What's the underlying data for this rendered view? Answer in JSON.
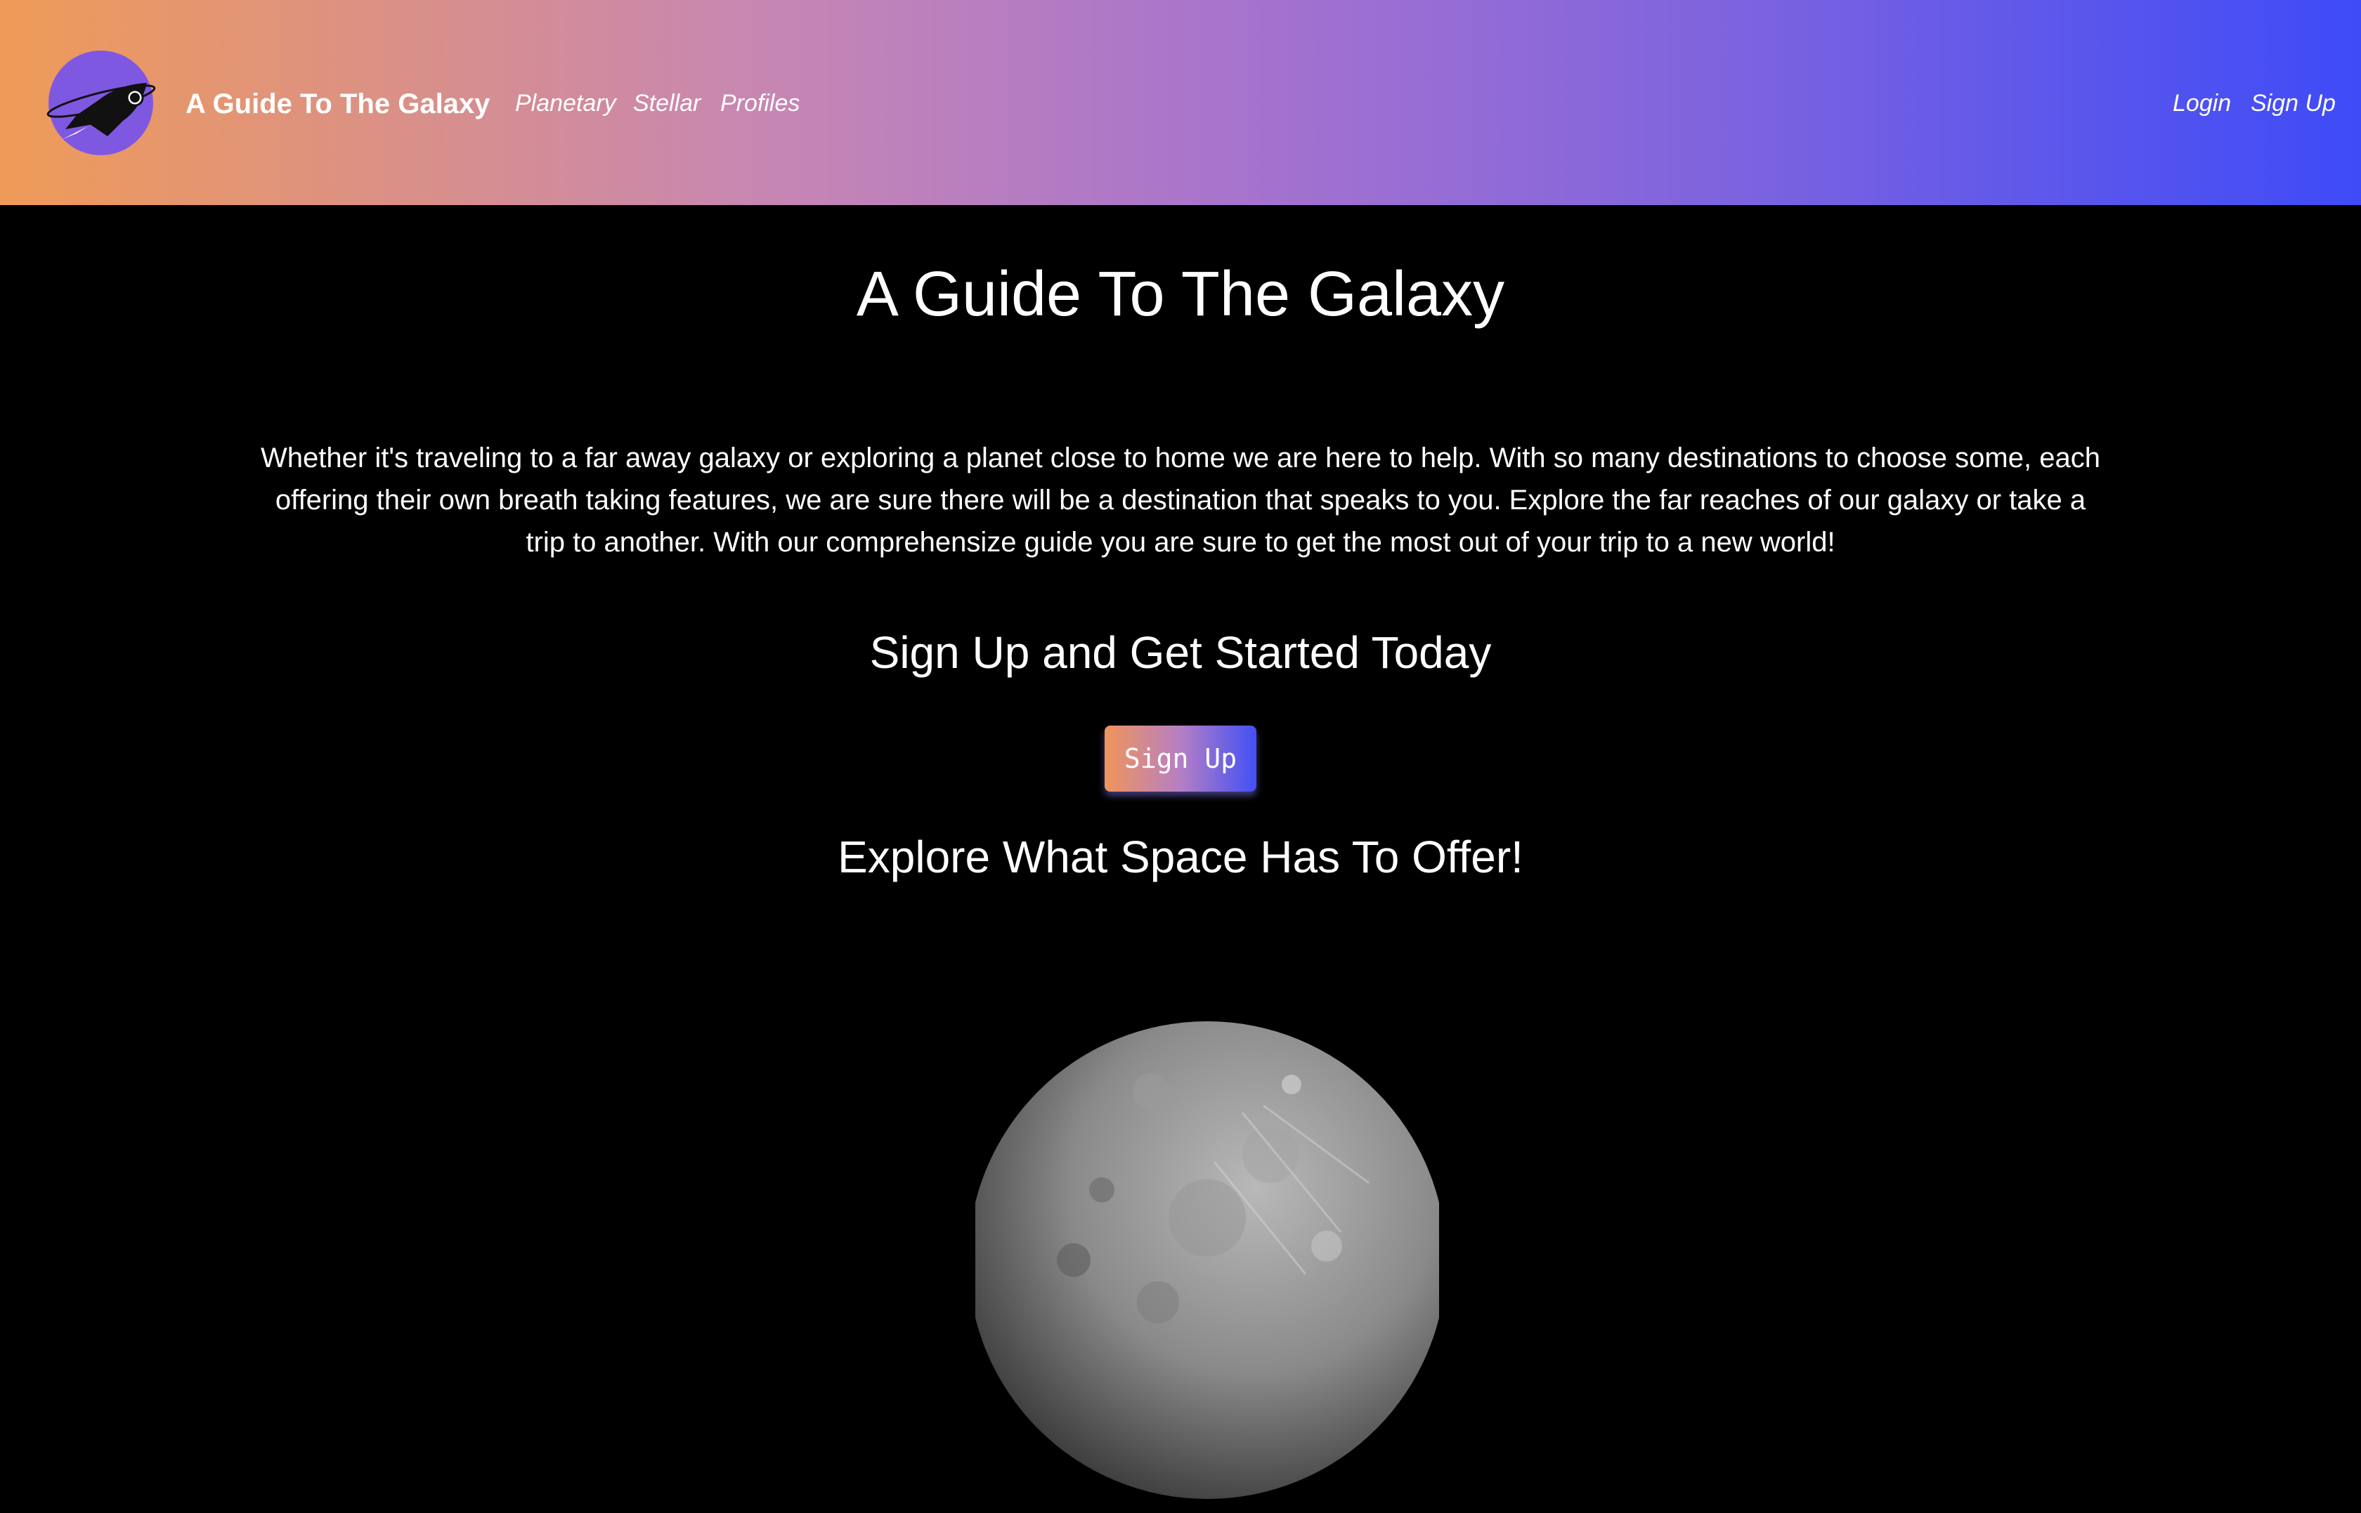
{
  "nav": {
    "brand": "A Guide To The Galaxy",
    "links": [
      "Planetary",
      "Stellar",
      "Profiles"
    ],
    "login": "Login",
    "signup": "Sign Up",
    "logo_icon": "rocket-icon"
  },
  "hero": {
    "title": "A Guide To The Galaxy",
    "intro": "Whether it's traveling to a far away galaxy or exploring a planet close to home we are here to help. With so many destinations to choose some, each offering their own breath taking features, we are sure there will be a destination that speaks to you. Explore the far reaches of our galaxy or take a trip to another. With our comprehensize guide you are sure to get the most out of your trip to a new world!",
    "cta_heading": "Sign Up and Get Started Today",
    "cta_button": "Sign Up",
    "explore_heading": "Explore What Space Has To Offer!"
  },
  "colors": {
    "nav_gradient_start": "#ef9b58",
    "nav_gradient_end": "#3e4bf7",
    "logo_bg": "#7f58e2",
    "background": "#000000",
    "text": "#ffffff"
  }
}
